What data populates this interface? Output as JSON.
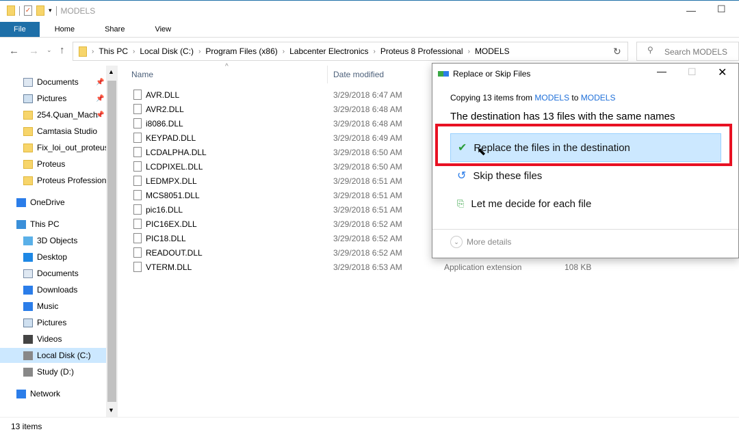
{
  "window": {
    "title": "MODELS"
  },
  "ribbon": {
    "tabs": [
      "File",
      "Home",
      "Share",
      "View"
    ]
  },
  "address": {
    "crumbs": [
      "This PC",
      "Local Disk (C:)",
      "Program Files (x86)",
      "Labcenter Electronics",
      "Proteus 8 Professional",
      "MODELS"
    ],
    "search_placeholder": "Search MODELS"
  },
  "nav": {
    "items": [
      {
        "label": "Documents",
        "icon": "documents-icon",
        "pinned": true
      },
      {
        "label": "Pictures",
        "icon": "pictures-icon",
        "pinned": true
      },
      {
        "label": "254.Quan_Mach",
        "icon": "folder-icon",
        "pinned": true
      },
      {
        "label": "Camtasia Studio",
        "icon": "folder-icon"
      },
      {
        "label": "Fix_loi_out_proteus",
        "icon": "folder-icon"
      },
      {
        "label": "Proteus",
        "icon": "folder-icon"
      },
      {
        "label": "Proteus Professiona",
        "icon": "folder-icon"
      },
      {
        "label": "OneDrive",
        "icon": "cloud-icon"
      },
      {
        "label": "This PC",
        "icon": "pc-icon"
      },
      {
        "label": "3D Objects",
        "icon": "3d-objects-icon"
      },
      {
        "label": "Desktop",
        "icon": "desktop-icon"
      },
      {
        "label": "Documents",
        "icon": "documents-icon"
      },
      {
        "label": "Downloads",
        "icon": "downloads-icon"
      },
      {
        "label": "Music",
        "icon": "music-icon"
      },
      {
        "label": "Pictures",
        "icon": "pictures-icon"
      },
      {
        "label": "Videos",
        "icon": "videos-icon"
      },
      {
        "label": "Local Disk (C:)",
        "icon": "drive-icon",
        "selected": true
      },
      {
        "label": "Study (D:)",
        "icon": "drive-icon"
      },
      {
        "label": "Network",
        "icon": "network-icon"
      }
    ]
  },
  "files": {
    "headers": [
      "Name",
      "Date modified"
    ],
    "rows": [
      {
        "name": "AVR.DLL",
        "date": "3/29/2018 6:47 AM"
      },
      {
        "name": "AVR2.DLL",
        "date": "3/29/2018 6:48 AM"
      },
      {
        "name": "i8086.DLL",
        "date": "3/29/2018 6:48 AM"
      },
      {
        "name": "KEYPAD.DLL",
        "date": "3/29/2018 6:49 AM"
      },
      {
        "name": "LCDALPHA.DLL",
        "date": "3/29/2018 6:50 AM"
      },
      {
        "name": "LCDPIXEL.DLL",
        "date": "3/29/2018 6:50 AM"
      },
      {
        "name": "LEDMPX.DLL",
        "date": "3/29/2018 6:51 AM"
      },
      {
        "name": "MCS8051.DLL",
        "date": "3/29/2018 6:51 AM"
      },
      {
        "name": "pic16.DLL",
        "date": "3/29/2018 6:51 AM"
      },
      {
        "name": "PIC16EX.DLL",
        "date": "3/29/2018 6:52 AM"
      },
      {
        "name": "PIC18.DLL",
        "date": "3/29/2018 6:52 AM"
      },
      {
        "name": "READOUT.DLL",
        "date": "3/29/2018 6:52 AM"
      },
      {
        "name": "VTERM.DLL",
        "date": "3/29/2018 6:53 AM",
        "type": "Application extension",
        "size": "108 KB"
      }
    ]
  },
  "status": {
    "count": "13 items"
  },
  "dialog": {
    "title": "Replace or Skip Files",
    "copy_prefix": "Copying 13 items from ",
    "source": "MODELS",
    "to": " to ",
    "dest": "MODELS",
    "heading": "The destination has 13 files with the same names",
    "options": [
      "Replace the files in the destination",
      "Skip these files",
      "Let me decide for each file"
    ],
    "more_details": "More details",
    "highlight_color": "#e81123"
  }
}
